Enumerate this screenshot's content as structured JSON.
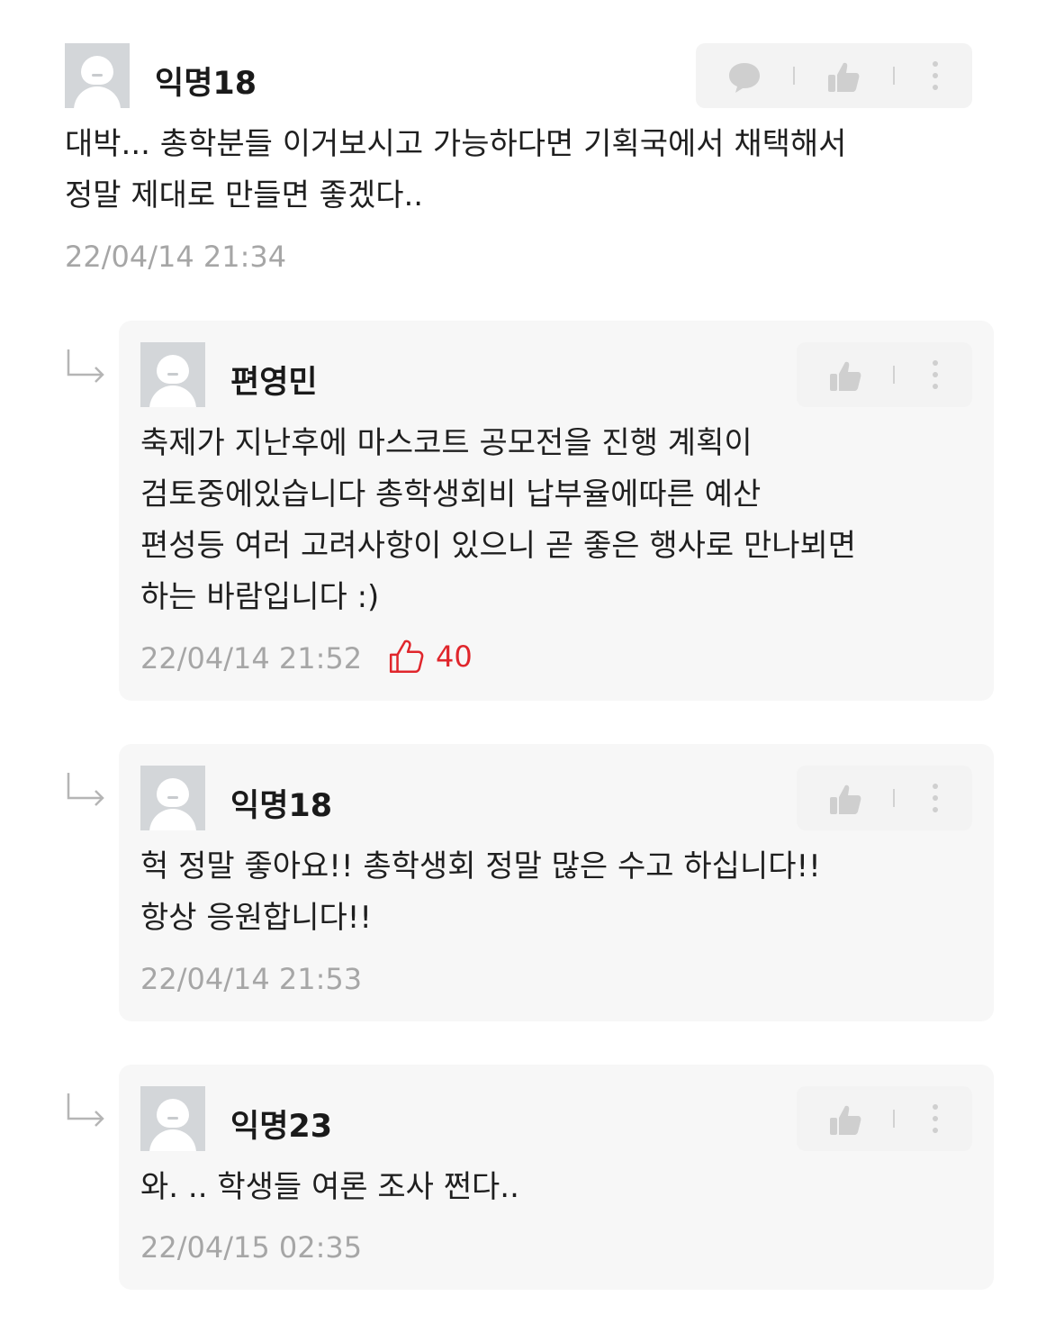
{
  "comments": [
    {
      "author": "익명18",
      "text": "대박... 총학분들 이거보시고 가능하다면 기획국에서 채택해서\n정말 제대로 만들면 좋겠다..",
      "time": "22/04/14 21:34"
    }
  ],
  "replies": [
    {
      "author": "편영민",
      "text": "축제가 지난후에 마스코트 공모전을 진행 계획이\n검토중에있습니다 총학생회비 납부율에따른 예산\n편성등 여러 고려사항이 있으니 곧 좋은 행사로 만나뵈면\n하는 바람입니다 :)",
      "time": "22/04/14 21:52",
      "likes": "40"
    },
    {
      "author": "익명18",
      "text": "헉 정말 좋아요!! 총학생회 정말 많은 수고 하십니다!!\n항상 응원합니다!!",
      "time": "22/04/14 21:53"
    },
    {
      "author": "익명23",
      "text": "와. .. 학생들 여론 조사 쩐다..",
      "time": "22/04/15 02:35"
    }
  ],
  "icons": {
    "comment": "speech-bubble-icon",
    "like": "thumbs-up-icon",
    "more": "more-vertical-icon",
    "reply": "reply-arrow-icon"
  },
  "colors": {
    "like_active": "#e0262c",
    "timestamp": "#a6a6a6",
    "card_bg": "#f7f7f7"
  }
}
